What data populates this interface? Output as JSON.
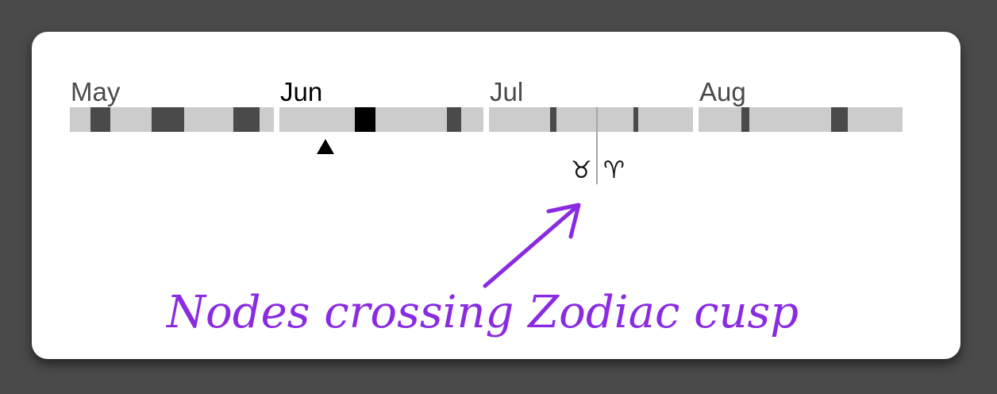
{
  "timeline": {
    "months": [
      {
        "label": "May",
        "label_color": "#4a4a4a",
        "blocks": [
          {
            "start": 1,
            "end": 2,
            "color": "#4a4a4a"
          },
          {
            "start": 4,
            "end": 5.6,
            "color": "#4a4a4a"
          },
          {
            "start": 8,
            "end": 9.3,
            "color": "#4a4a4a"
          }
        ]
      },
      {
        "label": "Jun",
        "label_color": "#000000",
        "blocks": [
          {
            "start": 3.7,
            "end": 4.7,
            "color": "#000000"
          },
          {
            "start": 8.2,
            "end": 8.9,
            "color": "#4a4a4a"
          }
        ]
      },
      {
        "label": "Jul",
        "label_color": "#4a4a4a",
        "blocks": [
          {
            "start": 3,
            "end": 3.3,
            "color": "#4a4a4a"
          },
          {
            "start": 7.1,
            "end": 7.3,
            "color": "#4a4a4a"
          }
        ]
      },
      {
        "label": "Aug",
        "label_color": "#4a4a4a",
        "blocks": [
          {
            "start": 2.1,
            "end": 2.5,
            "color": "#4a4a4a"
          },
          {
            "start": 6.5,
            "end": 7.3,
            "color": "#4a4a4a"
          }
        ]
      }
    ],
    "current_month": "Jun"
  },
  "cusp": {
    "left_glyph": "♉",
    "right_glyph": "♈"
  },
  "annotation": {
    "text": "Nodes crossing Zodiac cusp",
    "color": "#8a2be2"
  }
}
